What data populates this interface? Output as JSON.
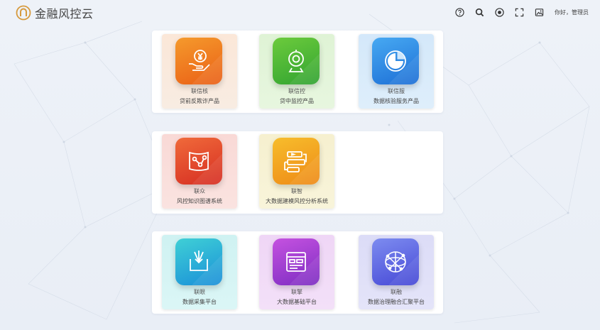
{
  "header": {
    "logo_text": "金融风控云",
    "greeting": "你好，管理员",
    "icons": [
      "help-icon",
      "search-icon",
      "play-icon",
      "fullscreen-icon",
      "image-icon"
    ]
  },
  "colors": {
    "orange": "#f07a1e",
    "green": "#3db33a",
    "blue": "#2f8be0",
    "red": "#e2462e",
    "yellow": "#f0a51e",
    "cyan": "#1fb6d8",
    "purple": "#9b3fd0",
    "indigo": "#5a63e2"
  },
  "panels": [
    {
      "cards": [
        {
          "name": "联信核",
          "desc": "贷前反欺诈产品",
          "icon": "yen-hand-icon"
        },
        {
          "name": "联信控",
          "desc": "贷中监控产品",
          "icon": "webcam-icon"
        },
        {
          "name": "联信服",
          "desc": "数据核验服务产品",
          "icon": "pie-chart-icon"
        }
      ]
    },
    {
      "cards": [
        {
          "name": "联众",
          "desc": "风控知识图谱系统",
          "icon": "knowledge-graph-icon"
        },
        {
          "name": "联智",
          "desc": "大数据建模风控分析系统",
          "icon": "modeling-icon"
        }
      ]
    },
    {
      "cards": [
        {
          "name": "联眼",
          "desc": "数据采集平台",
          "icon": "collect-icon"
        },
        {
          "name": "联擎",
          "desc": "大数据基础平台",
          "icon": "dashboard-icon"
        },
        {
          "name": "联融",
          "desc": "数据治理融合汇聚平台",
          "icon": "globe-icon"
        }
      ]
    }
  ]
}
